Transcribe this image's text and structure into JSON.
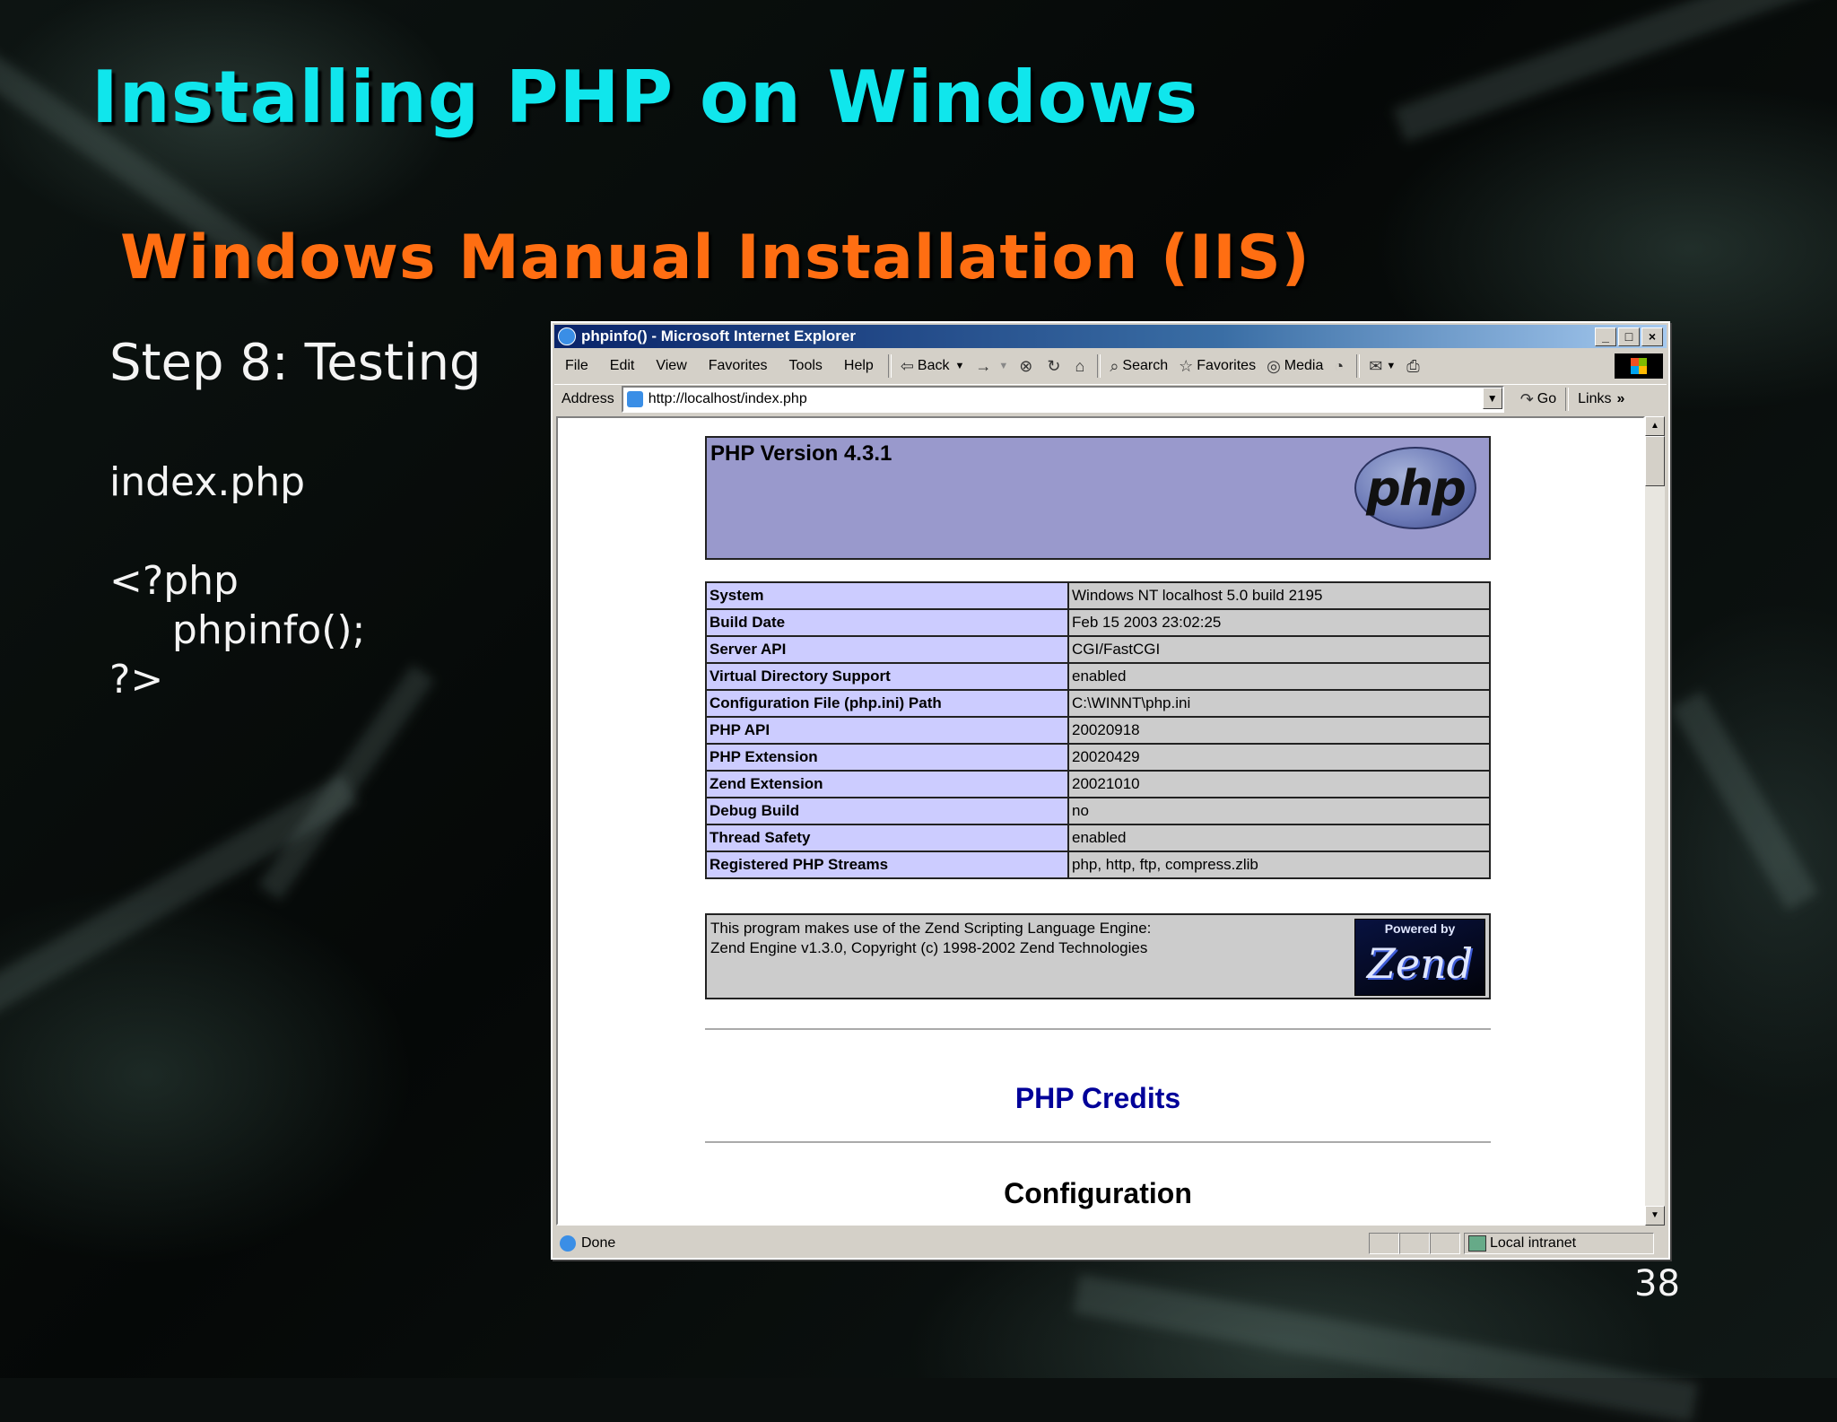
{
  "slide": {
    "title": "Installing PHP on Windows",
    "subtitle": "Windows Manual Installation (IIS)",
    "step": "Step 8: Testing",
    "filename": "index.php",
    "code_lines": [
      "<?php",
      "     phpinfo();",
      "?>"
    ],
    "page_number": "38",
    "colors": {
      "title": "#10e6ec",
      "subtitle": "#ff6e12",
      "text": "#f4f4f4"
    }
  },
  "browser": {
    "window_title": "phpinfo() - Microsoft Internet Explorer",
    "window_buttons": [
      "_",
      "□",
      "×"
    ],
    "menu": [
      "File",
      "Edit",
      "View",
      "Favorites",
      "Tools",
      "Help"
    ],
    "toolbar": {
      "back": "Back",
      "forward": "→",
      "search": "Search",
      "favorites": "Favorites",
      "media": "Media",
      "icons": [
        "back-arrow-icon",
        "forward-arrow-icon",
        "stop-icon",
        "refresh-icon",
        "home-icon",
        "search-icon",
        "favorites-icon",
        "media-icon",
        "history-icon",
        "mail-icon",
        "print-icon"
      ]
    },
    "address_label": "Address",
    "url": "http://localhost/index.php",
    "go_label": "Go",
    "links_label": "Links",
    "status_text": "Done",
    "zone_text": "Local intranet"
  },
  "phpinfo": {
    "version": "PHP Version 4.3.1",
    "logo_text": "php",
    "rows": [
      [
        "System",
        "Windows NT localhost 5.0 build 2195"
      ],
      [
        "Build Date",
        "Feb 15 2003 23:02:25"
      ],
      [
        "Server API",
        "CGI/FastCGI"
      ],
      [
        "Virtual Directory Support",
        "enabled"
      ],
      [
        "Configuration File (php.ini) Path",
        "C:\\WINNT\\php.ini"
      ],
      [
        "PHP API",
        "20020918"
      ],
      [
        "PHP Extension",
        "20020429"
      ],
      [
        "Zend Extension",
        "20021010"
      ],
      [
        "Debug Build",
        "no"
      ],
      [
        "Thread Safety",
        "enabled"
      ],
      [
        "Registered PHP Streams",
        "php, http, ftp, compress.zlib"
      ]
    ],
    "zend_line1": "This program makes use of the Zend Scripting Language Engine:",
    "zend_line2": "Zend Engine v1.3.0, Copyright (c) 1998-2002 Zend Technologies",
    "zend_logo_powered": "Powered by",
    "zend_logo_name": "Zend",
    "credits_heading": "PHP Credits",
    "configuration_heading": "Configuration"
  }
}
